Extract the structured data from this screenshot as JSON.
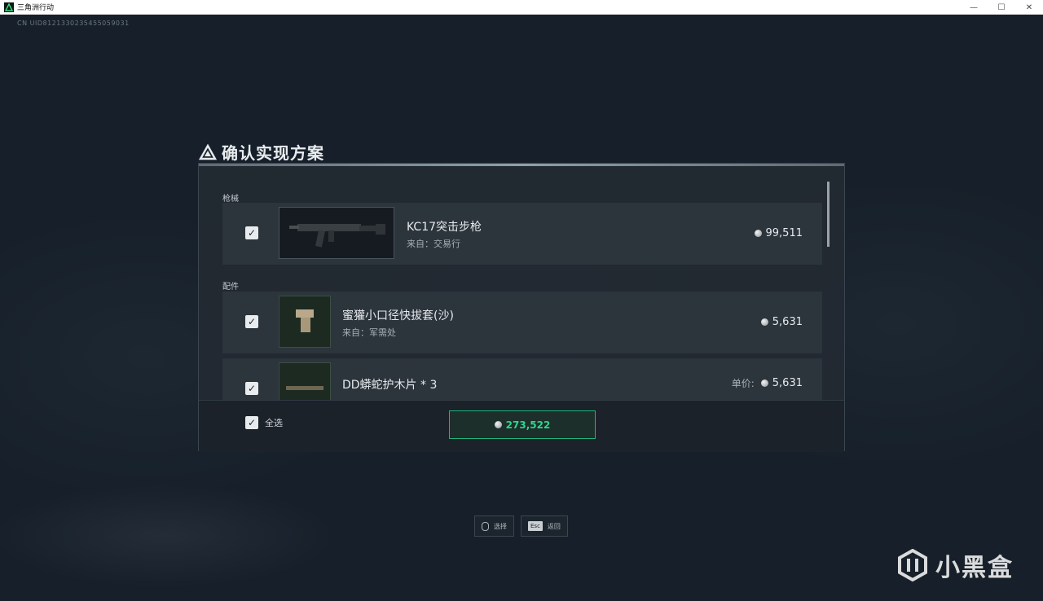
{
  "window": {
    "title": "三角洲行动",
    "controls": [
      "—",
      "☐",
      "✕"
    ]
  },
  "uid_text": "CN UID8121330235455059031",
  "dialog": {
    "title": "确认实现方案",
    "sections": [
      {
        "label": "枪械",
        "items": [
          {
            "name": "KC17突击步枪",
            "source": "来自：交易行",
            "price": "99,511",
            "checked": true
          }
        ]
      },
      {
        "label": "配件",
        "items": [
          {
            "name": "蜜獾小口径快拔套(沙)",
            "source": "来自：军需处",
            "price": "5,631",
            "checked": true
          },
          {
            "name": "DD蟒蛇护木片 * 3",
            "unit_label": "单价:",
            "price": "5,631",
            "checked": true
          }
        ]
      }
    ],
    "select_all_label": "全选",
    "total": "273,522",
    "accent_color": "#2fd58e"
  },
  "hints": [
    {
      "key": "mouse-icon",
      "label": "选择"
    },
    {
      "key": "Esc",
      "label": "返回"
    }
  ],
  "watermark": {
    "text": "小黑盒"
  }
}
